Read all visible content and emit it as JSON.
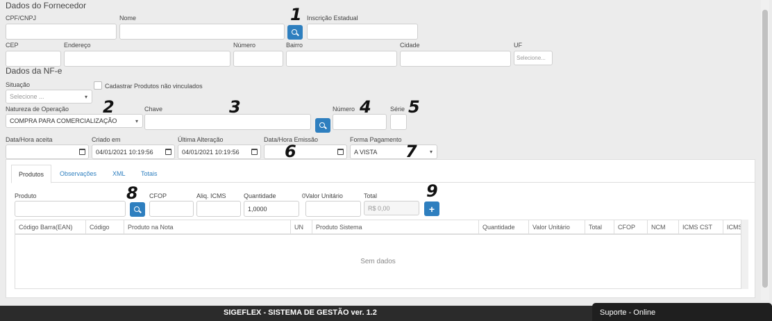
{
  "supplier": {
    "section_title": "Dados do Fornecedor",
    "cpf_label": "CPF/CNPJ",
    "name_label": "Nome",
    "state_reg_label": "Inscrição Estadual",
    "cep_label": "CEP",
    "address_label": "Endereço",
    "number_label": "Número",
    "district_label": "Bairro",
    "city_label": "Cidade",
    "uf_label": "UF",
    "uf_value": "Selecione..."
  },
  "nfe": {
    "section_title": "Dados da NF-e",
    "situation_label": "Situação",
    "situation_value": "Selecione ...",
    "register_unlinked_label": "Cadastrar Produtos não vinculados",
    "operation_label": "Natureza de Operação",
    "operation_value": "COMPRA PARA COMERCIALIZAÇÃO",
    "key_label": "Chave",
    "number_label": "Número",
    "series_label": "Série",
    "accepted_label": "Data/Hora aceita",
    "created_label": "Criado em",
    "created_value": "04/01/2021 10:19:56",
    "updated_label": "Última Alteração",
    "updated_value": "04/01/2021 10:19:56",
    "issued_label": "Data/Hora Emissão",
    "payment_label": "Forma Pagamento",
    "payment_value": "A VISTA"
  },
  "tabs": [
    "Produtos",
    "Observações",
    "XML",
    "Totais"
  ],
  "product_form": {
    "product_label": "Produto",
    "cfop_label": "CFOP",
    "icms_label": "Aliq. ICMS",
    "qty_label": "Quantidade",
    "qty_value": "1,0000",
    "unit_value_label": "0Valor Unitário",
    "total_label": "Total",
    "total_placeholder": "R$ 0,00"
  },
  "table": {
    "columns": [
      "Código Barra(EAN)",
      "Código",
      "Produto na Nota",
      "UN",
      "Produto Sistema",
      "Quantidade",
      "Valor Unitário",
      "Total",
      "CFOP",
      "NCM",
      "ICMS CST",
      "ICMS"
    ],
    "empty_text": "Sem dados"
  },
  "annotations": [
    "1",
    "2",
    "3",
    "4",
    "5",
    "6",
    "7",
    "8",
    "9"
  ],
  "footer": {
    "title": "SIGEFLEX - SISTEMA DE GESTÃO ver. 1.2",
    "support": "Suporte - Online"
  },
  "colors": {
    "accent": "#2e7fbf",
    "footer_bg": "#2b2b2b"
  },
  "icons": {
    "search": "search-icon",
    "add": "plus-icon",
    "calendar": "calendar-icon"
  }
}
